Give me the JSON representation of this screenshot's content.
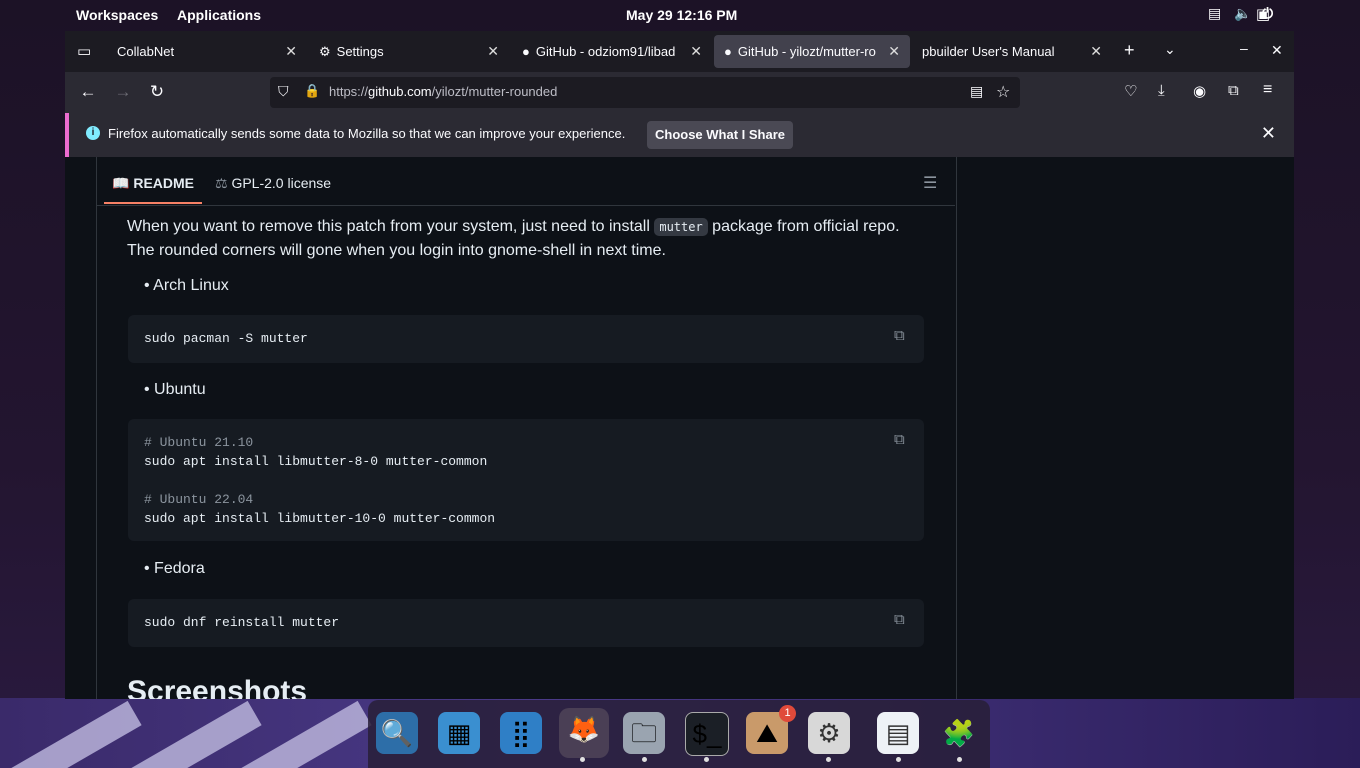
{
  "topbar": {
    "workspaces": "Workspaces",
    "applications": "Applications",
    "datetime": "May 29  12:16 PM"
  },
  "tabs": [
    {
      "label": "CollabNet"
    },
    {
      "label": "Settings"
    },
    {
      "label": "GitHub - odziom91/libad"
    },
    {
      "label": "GitHub - yilozt/mutter-ro"
    },
    {
      "label": "pbuilder User's Manual"
    }
  ],
  "url": {
    "prefix": "https://",
    "host": "github.com",
    "path": "/yilozt/mutter-rounded"
  },
  "notification": {
    "text": "Firefox automatically sends some data to Mozilla so that we can improve your experience.",
    "button": "Choose What I Share"
  },
  "readme": {
    "tab_readme": "README",
    "tab_license": "GPL-2.0 license",
    "para_1a": "When you want to remove this patch from your system, just need to install",
    "para_code": "mutter",
    "para_1b": "package from official repo.",
    "para_2": "The rounded corners will gone when you login into gnome-shell in next time.",
    "bullet_arch": "Arch Linux",
    "code_arch": "sudo pacman -S mutter",
    "bullet_ubuntu": "Ubuntu",
    "code_ubuntu_c1": "# Ubuntu 21.10",
    "code_ubuntu_l1": "sudo apt install libmutter-8-0 mutter-common",
    "code_ubuntu_c2": "# Ubuntu 22.04",
    "code_ubuntu_l2": "sudo apt install libmutter-10-0 mutter-common",
    "bullet_fedora": "Fedora",
    "code_fedora": "sudo dnf reinstall mutter",
    "heading_screenshots": "Screenshots"
  },
  "dock": {
    "badge": "1"
  }
}
